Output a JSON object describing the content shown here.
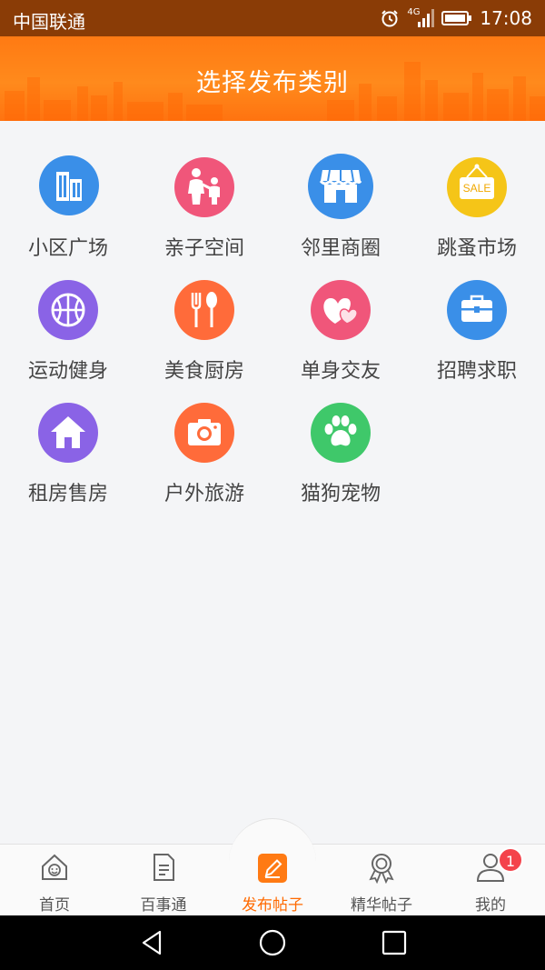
{
  "status_bar": {
    "carrier": "中国联通",
    "network": "4G",
    "time": "17:08",
    "icons": [
      "alarm-icon",
      "signal-icon",
      "battery-icon"
    ]
  },
  "header": {
    "title": "选择发布类别",
    "background_color": "#ff7a13"
  },
  "categories": [
    {
      "label": "小区广场",
      "icon": "building-icon",
      "color": "#3a8fe8"
    },
    {
      "label": "亲子空间",
      "icon": "parent-child-icon",
      "color": "#f0567a"
    },
    {
      "label": "邻里商圈",
      "icon": "shop-icon",
      "color": "#3a8fe8"
    },
    {
      "label": "跳蚤市场",
      "icon": "sale-sign-icon",
      "color": "#f5c518",
      "icon_text": "SALE"
    },
    {
      "label": "运动健身",
      "icon": "basketball-icon",
      "color": "#8a63e6"
    },
    {
      "label": "美食厨房",
      "icon": "fork-spoon-icon",
      "color": "#ff6b3a"
    },
    {
      "label": "单身交友",
      "icon": "hearts-icon",
      "color": "#f0567a"
    },
    {
      "label": "招聘求职",
      "icon": "briefcase-icon",
      "color": "#3a8fe8"
    },
    {
      "label": "租房售房",
      "icon": "house-icon",
      "color": "#8a63e6"
    },
    {
      "label": "户外旅游",
      "icon": "camera-icon",
      "color": "#ff6b3a"
    },
    {
      "label": "猫狗宠物",
      "icon": "paw-icon",
      "color": "#3fc86a"
    }
  ],
  "bottom_nav": {
    "items": [
      {
        "label": "首页",
        "icon": "home-icon"
      },
      {
        "label": "百事通",
        "icon": "document-icon"
      },
      {
        "label": "发布帖子",
        "icon": "edit-icon",
        "active": true
      },
      {
        "label": "精华帖子",
        "icon": "award-icon"
      },
      {
        "label": "我的",
        "icon": "user-icon",
        "badge": "1"
      }
    ],
    "active_color": "#ff6a00"
  },
  "system_nav": {
    "icons": [
      "back-icon",
      "home-circle-icon",
      "recents-icon"
    ]
  }
}
